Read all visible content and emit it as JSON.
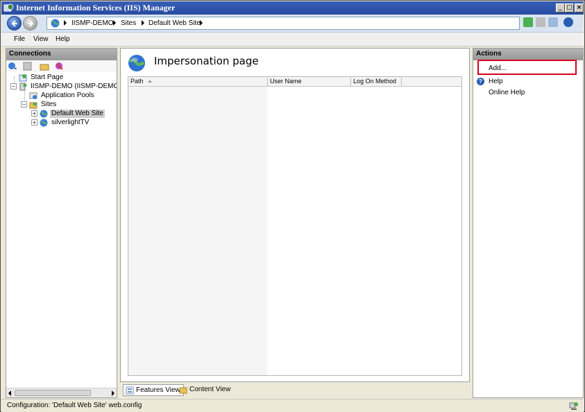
{
  "window": {
    "title": "Internet Information Services (IIS) Manager",
    "min_glyph": "_",
    "max_glyph": "□",
    "close_glyph": "×"
  },
  "address": {
    "crumbs": [
      "IISMP-DEMO",
      "Sites",
      "Default Web Site"
    ]
  },
  "menu": {
    "items": [
      "File",
      "View",
      "Help"
    ]
  },
  "connections": {
    "header": "Connections",
    "tree": {
      "start_page": "Start Page",
      "server": "IISMP-DEMO (IISMP-DEMO\\Admi",
      "app_pools": "Application Pools",
      "sites": "Sites",
      "default_site": "Default Web Site",
      "silverlight": "silverlightTV"
    }
  },
  "main": {
    "title": "Impersonation page",
    "columns": [
      "Path",
      "User Name",
      "Log On Method"
    ],
    "rows": []
  },
  "view_tabs": {
    "features": "Features View",
    "content": "Content View"
  },
  "actions": {
    "header": "Actions",
    "add": "Add...",
    "help": "Help",
    "online_help": "Online Help"
  },
  "status": {
    "text": "Configuration: 'Default Web Site' web.config"
  },
  "colors": {
    "titlebar": "#2a4fa6",
    "highlight": "#d6001c",
    "link": "#000000"
  }
}
